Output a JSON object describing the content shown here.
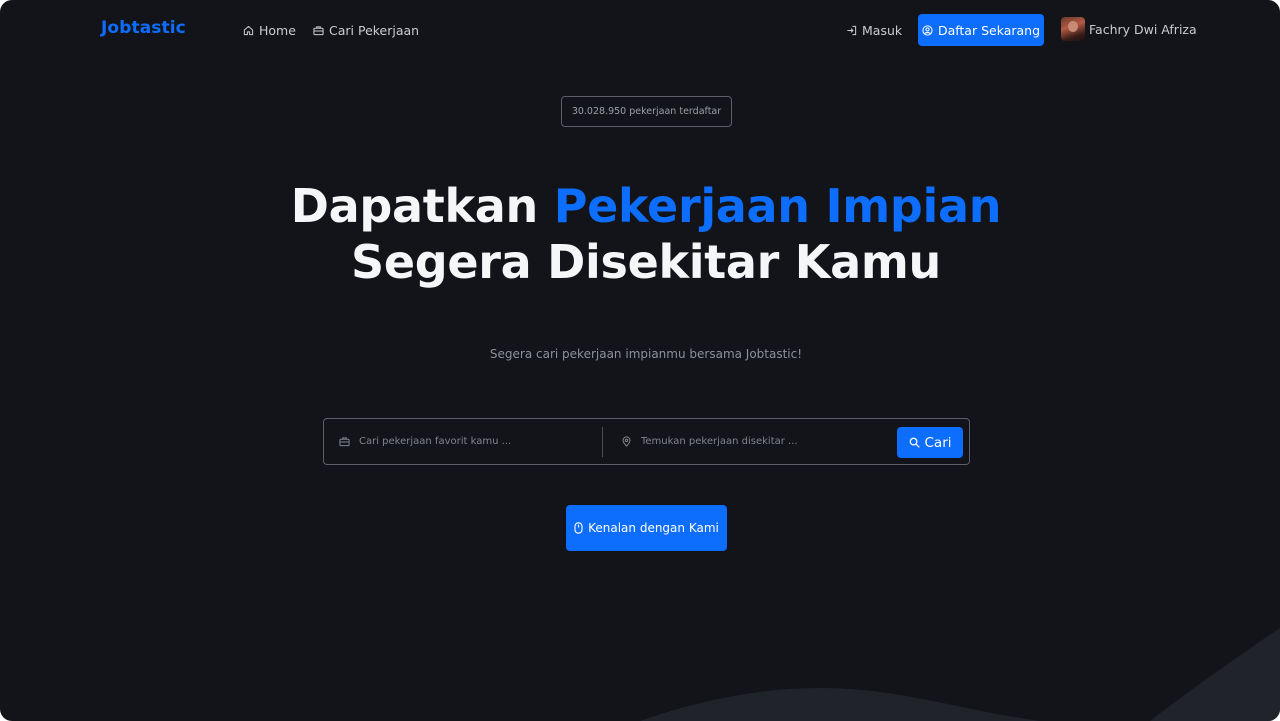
{
  "nav": {
    "brand": "Jobtastic",
    "home_label": "Home",
    "jobs_label": "Cari Pekerjaan",
    "login_label": "Masuk",
    "register_label": "Daftar Sekarang",
    "user_name": "Fachry Dwi Afriza"
  },
  "hero": {
    "badge": "30.028.950 pekerjaan terdaftar",
    "headline_part1": "Dapatkan ",
    "headline_accent": "Pekerjaan Impian",
    "headline_line2": "Segera Disekitar Kamu",
    "subtitle": "Segera cari pekerjaan impianmu bersama Jobtastic!"
  },
  "search": {
    "job_placeholder": "Cari pekerjaan favorit kamu ...",
    "location_placeholder": "Temukan pekerjaan disekitar ...",
    "button_label": "Cari"
  },
  "cta": {
    "label": "Kenalan dengan Kami"
  },
  "colors": {
    "background": "#121419",
    "accent": "#0d6efd",
    "text": "#f5f6f8",
    "muted": "#8c9198"
  },
  "icons": {
    "home": "home-icon",
    "jobs": "briefcase-icon",
    "login": "login-icon",
    "register": "user-circle-icon",
    "job_field": "briefcase-icon",
    "location_field": "map-pin-icon",
    "search_button": "search-icon",
    "cta": "mouse-icon"
  }
}
